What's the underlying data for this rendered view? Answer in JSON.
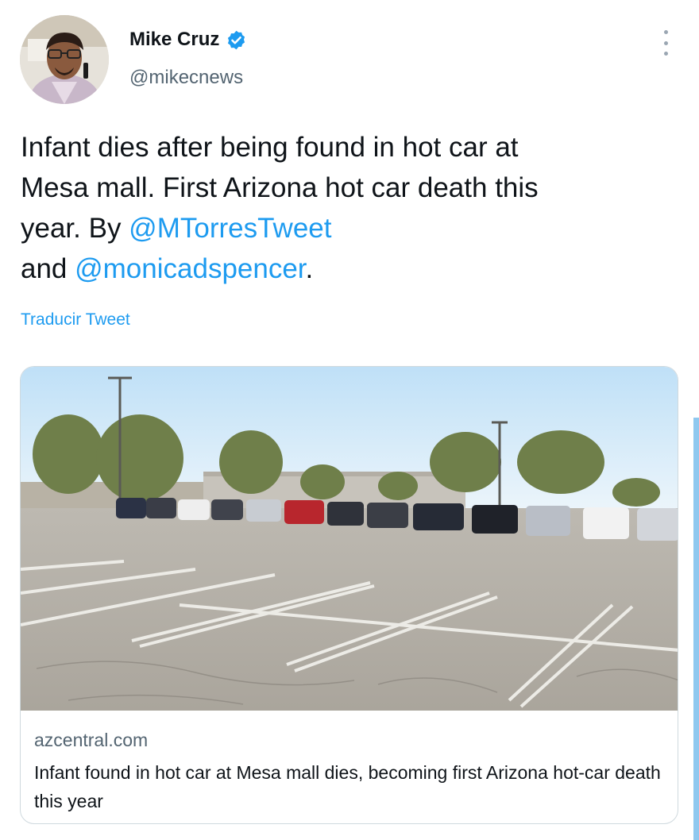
{
  "author": {
    "display_name": "Mike Cruz",
    "handle": "@mikecnews",
    "verified": true,
    "verified_icon": "verified-badge-icon",
    "avatar_icon": "profile-photo"
  },
  "menu": {
    "icon": "more-vertical-icon"
  },
  "tweet": {
    "line1": "Infant dies after being found in hot car at",
    "line2": "Mesa mall. First Arizona hot car death this",
    "line3_prefix": "year. By ",
    "mention1": "@MTorresTweet",
    "line4_prefix": "and ",
    "mention2": "@monicadspencer",
    "line4_suffix": "."
  },
  "translate_label": "Traducir Tweet",
  "card": {
    "image_icon": "parking-lot-photo",
    "domain": "azcentral.com",
    "title": "Infant found in hot car at Mesa mall dies, becoming first Arizona hot-car death this year"
  },
  "colors": {
    "accent": "#1d9bf0",
    "text": "#0f1419",
    "secondary": "#536471",
    "border": "#cfd9de",
    "scrollbar": "#8fc8ef"
  }
}
